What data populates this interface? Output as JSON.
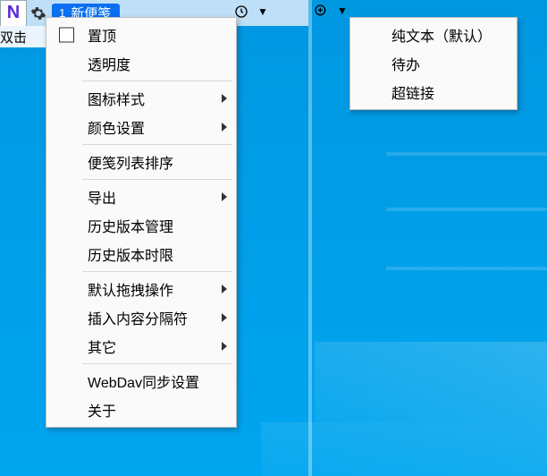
{
  "app": {
    "logo_letter": "N",
    "tab_index": "1",
    "tab_title": "新便笺",
    "hint_text": "双击"
  },
  "toolbar": {
    "zoom_out": "−",
    "dropdown": "▼",
    "zoom_in": "+",
    "dropdown2": "▼"
  },
  "menu": {
    "pin_top": "置顶",
    "opacity": "透明度",
    "icon_style": "图标样式",
    "color_settings": "颜色设置",
    "note_list_sort": "便笺列表排序",
    "export": "导出",
    "history_manage": "历史版本管理",
    "history_limit": "历史版本时限",
    "default_drag": "默认拖拽操作",
    "insert_separator": "插入内容分隔符",
    "other": "其它",
    "webdav": "WebDav同步设置",
    "about": "关于"
  },
  "submenu": {
    "plain_text": "纯文本（默认）",
    "todo": "待办",
    "hyperlink": "超链接"
  }
}
